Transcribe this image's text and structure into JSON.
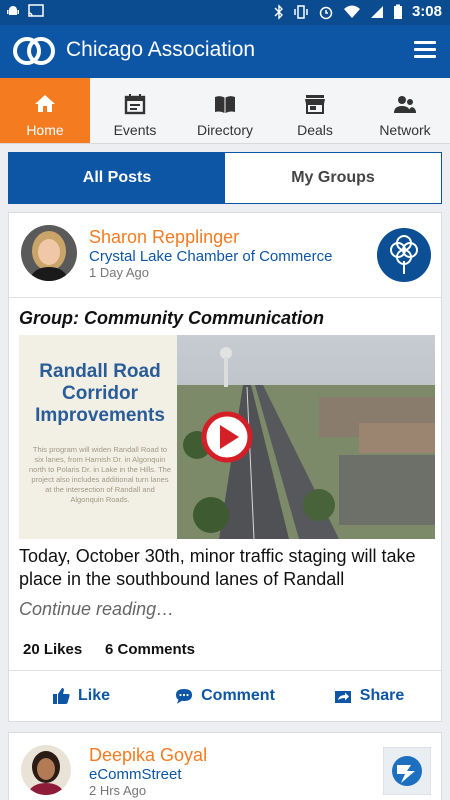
{
  "status_bar": {
    "time": "3:08",
    "battery_level": "z"
  },
  "app_bar": {
    "title": "Chicago Association"
  },
  "nav_tabs": [
    {
      "label": "Home",
      "icon": "home-icon",
      "active": true
    },
    {
      "label": "Events",
      "icon": "calendar-icon",
      "active": false
    },
    {
      "label": "Directory",
      "icon": "book-icon",
      "active": false
    },
    {
      "label": "Deals",
      "icon": "store-icon",
      "active": false
    },
    {
      "label": "Network",
      "icon": "people-icon",
      "active": false
    }
  ],
  "segments": {
    "all_posts": "All Posts",
    "my_groups": "My Groups"
  },
  "posts": [
    {
      "author": "Sharon Repplinger",
      "organization": "Crystal Lake Chamber of Commerce",
      "time_ago": "1 Day Ago",
      "group": "Group: Community Communication",
      "media": {
        "heading_line1": "Randall Road",
        "heading_line2": "Corridor",
        "heading_line3": "Improvements",
        "body": "This program will widen Randall Road to six lanes, from Harnish Dr. in Algonquin north to Polaris Dr. in Lake in the Hills. The project also includes additional turn lanes at the intersection of Randall and Algonquin Roads."
      },
      "text": "Today, October 30th, minor traffic staging will take place in the southbound lanes of Randall",
      "continue": "Continue reading…",
      "likes": "20 Likes",
      "comments": "6 Comments",
      "actions": {
        "like": "Like",
        "comment": "Comment",
        "share": "Share"
      }
    },
    {
      "author": "Deepika Goyal",
      "organization": "eCommStreet",
      "time_ago": "2 Hrs Ago"
    }
  ],
  "colors": {
    "brand_blue": "#0d56a6",
    "status_blue": "#0b4b8f",
    "accent_orange": "#f47b20"
  }
}
